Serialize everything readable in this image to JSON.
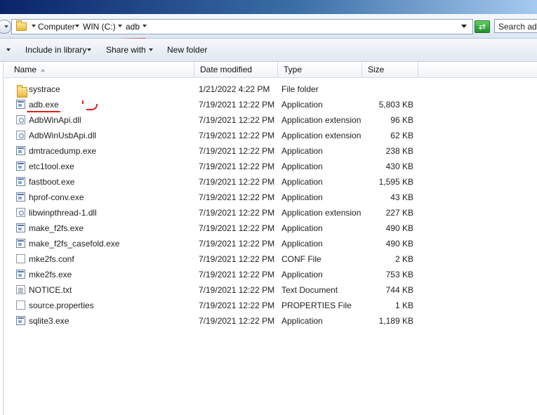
{
  "address_bar": {
    "crumbs": [
      "Computer",
      "WIN (C:)",
      "adb"
    ],
    "search_placeholder": "Search adb"
  },
  "toolbar": {
    "include_in_library": "Include in library",
    "share_with": "Share with",
    "new_folder": "New folder"
  },
  "columns": {
    "name": "Name",
    "date_modified": "Date modified",
    "type": "Type",
    "size": "Size"
  },
  "files": [
    {
      "name": "systrace",
      "date": "1/21/2022 4:22 PM",
      "type": "File folder",
      "size": "",
      "icon": "folder-icon"
    },
    {
      "name": "adb.exe",
      "date": "7/19/2021 12:22 PM",
      "type": "Application",
      "size": "5,803 KB",
      "icon": "application-icon"
    },
    {
      "name": "AdbWinApi.dll",
      "date": "7/19/2021 12:22 PM",
      "type": "Application extension",
      "size": "96 KB",
      "icon": "dll-icon"
    },
    {
      "name": "AdbWinUsbApi.dll",
      "date": "7/19/2021 12:22 PM",
      "type": "Application extension",
      "size": "62 KB",
      "icon": "dll-icon"
    },
    {
      "name": "dmtracedump.exe",
      "date": "7/19/2021 12:22 PM",
      "type": "Application",
      "size": "238 KB",
      "icon": "application-icon"
    },
    {
      "name": "etc1tool.exe",
      "date": "7/19/2021 12:22 PM",
      "type": "Application",
      "size": "430 KB",
      "icon": "application-icon"
    },
    {
      "name": "fastboot.exe",
      "date": "7/19/2021 12:22 PM",
      "type": "Application",
      "size": "1,595 KB",
      "icon": "application-icon"
    },
    {
      "name": "hprof-conv.exe",
      "date": "7/19/2021 12:22 PM",
      "type": "Application",
      "size": "43 KB",
      "icon": "application-icon"
    },
    {
      "name": "libwinpthread-1.dll",
      "date": "7/19/2021 12:22 PM",
      "type": "Application extension",
      "size": "227 KB",
      "icon": "dll-icon"
    },
    {
      "name": "make_f2fs.exe",
      "date": "7/19/2021 12:22 PM",
      "type": "Application",
      "size": "490 KB",
      "icon": "application-icon"
    },
    {
      "name": "make_f2fs_casefold.exe",
      "date": "7/19/2021 12:22 PM",
      "type": "Application",
      "size": "490 KB",
      "icon": "application-icon"
    },
    {
      "name": "mke2fs.conf",
      "date": "7/19/2021 12:22 PM",
      "type": "CONF File",
      "size": "2 KB",
      "icon": "file-icon"
    },
    {
      "name": "mke2fs.exe",
      "date": "7/19/2021 12:22 PM",
      "type": "Application",
      "size": "753 KB",
      "icon": "application-icon"
    },
    {
      "name": "NOTICE.txt",
      "date": "7/19/2021 12:22 PM",
      "type": "Text Document",
      "size": "744 KB",
      "icon": "text-document-icon"
    },
    {
      "name": "source.properties",
      "date": "7/19/2021 12:22 PM",
      "type": "PROPERTIES File",
      "size": "1 KB",
      "icon": "file-icon"
    },
    {
      "name": "sqlite3.exe",
      "date": "7/19/2021 12:22 PM",
      "type": "Application",
      "size": "1,189 KB",
      "icon": "application-icon"
    }
  ],
  "colors": {
    "title_gradient_start": "#0a246a",
    "annotation_red": "#e02020",
    "refresh_green": "#1f8f2a"
  }
}
